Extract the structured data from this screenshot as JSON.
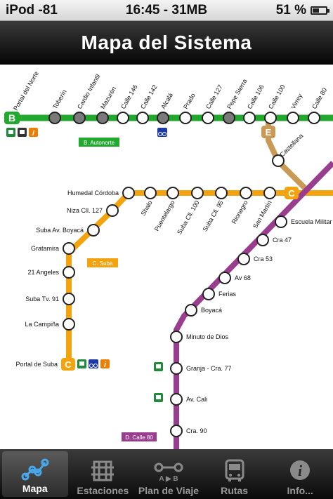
{
  "status_bar": {
    "carrier": "iPod -81",
    "center": "16:45 - 31MB",
    "battery": "51 %",
    "battery_level": 0.51
  },
  "header": {
    "title": "Mapa del Sistema"
  },
  "map": {
    "line_b_badge": "B",
    "line_b_name": "B. Autonorte",
    "line_c_badge": "C",
    "line_c_name": "C. Suba",
    "line_d_name": "D. Calle 80",
    "line_e_badge": "E",
    "stations_b": [
      "Portal del Norte",
      "Toberín",
      "Cardio Infantil",
      "Mazurén",
      "Calle 146",
      "Calle 142",
      "Alcalá",
      "Prado",
      "Calle 127",
      "Pepe Sierra",
      "Calle 106",
      "Calle 100",
      "Virrey",
      "Calle 80"
    ],
    "stations_c_h": [
      "Shalo",
      "Puentelargo",
      "Suba Cll. 100",
      "Suba Cll. 95",
      "Rionegro",
      "San Martín"
    ],
    "stations_c_v": [
      "Humedal Córdoba",
      "Niza Cll. 127",
      "Suba Av. Boyacá",
      "Gratamira",
      "21 Angeles",
      "Suba Tv. 91",
      "La Campiña",
      "Portal de Suba"
    ],
    "station_e": "Castellana",
    "stations_d": [
      "Escuela Militar",
      "Cra 47",
      "Cra 53",
      "Av 68",
      "Ferias",
      "Boyacá",
      "Minuto de Dios",
      "Granja - Cra. 77",
      "Av. Cali",
      "Cra. 90"
    ],
    "colors": {
      "green": "#22a82e",
      "orange": "#f2a30e",
      "tan": "#c99a55",
      "purple": "#9a3d8f",
      "blue": "#1c3aa6"
    }
  },
  "tabs": [
    {
      "label": "Mapa",
      "icon": "map-network-icon"
    },
    {
      "label": "Estaciones",
      "icon": "station-icon"
    },
    {
      "label": "Plan de Viaje",
      "icon": "route-planner-icon",
      "icon_text": "A ▶ B"
    },
    {
      "label": "Rutas",
      "icon": "bus-icon"
    },
    {
      "label": "Info...",
      "icon": "info-icon",
      "icon_text": "i"
    }
  ]
}
